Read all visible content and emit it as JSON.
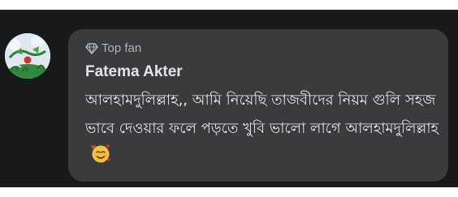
{
  "comment": {
    "badge_label": "Top fan",
    "badge_icon": "diamond-icon",
    "author_name": "Fatema Akter",
    "text": "আলহামদুলিল্লাহ,,  আমি নিয়েছি তাজবীদের নিয়ম গুলি সহজ ভাবে দেওয়ার ফলে পড়তে খুবি ভালো লাগে আলহামদুলিল্লাহ",
    "reaction_emoji_icon": "smiling-face-with-hearts-icon"
  },
  "colors": {
    "panel_background": "#18191a",
    "bubble_background": "#3a3b3c",
    "primary_text": "#e4e6eb",
    "secondary_text": "#b0b3b8"
  }
}
